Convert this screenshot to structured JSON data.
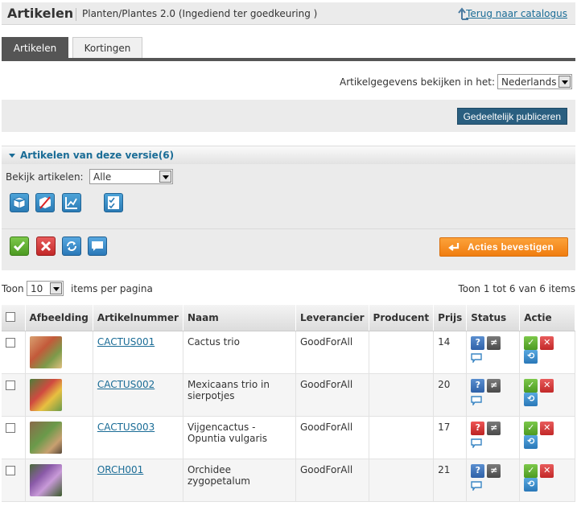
{
  "header": {
    "title": "Artikelen",
    "subtitle": "Planten/Plantes 2.0  (Ingediend ter goedkeuring )",
    "back_link": "Terug naar catalogus"
  },
  "tabs": [
    {
      "label": "Artikelen",
      "active": true
    },
    {
      "label": "Kortingen",
      "active": false
    }
  ],
  "language": {
    "label": "Artikelgegevens bekijken in het:",
    "selected": "Nederlands"
  },
  "publish_button": "Gedeeltelijk publiceren",
  "section": {
    "title": "Artikelen van deze versie(6)"
  },
  "filter": {
    "label": "Bekijk artikelen:",
    "selected": "Alle"
  },
  "filter_icons": [
    "cube-icon",
    "cube-crossed-icon",
    "chart-icon",
    "checklist-icon"
  ],
  "action_icons": [
    "check-icon",
    "cross-icon",
    "cycle-icon",
    "comment-icon"
  ],
  "confirm_button": "Acties bevestigen",
  "pager": {
    "show_label": "Toon",
    "per_page": "10",
    "per_page_label": "items per pagina",
    "summary": "Toon 1 tot 6 van 6 items"
  },
  "table": {
    "columns": [
      "",
      "Afbeelding",
      "Artikelnummer",
      "Naam",
      "Leverancier",
      "Producent",
      "Prijs",
      "Status",
      "Actie"
    ],
    "rows": [
      {
        "number": "CACTUS001",
        "name": "Cactus trio",
        "supplier": "GoodForAll",
        "producer": "",
        "price": "14",
        "status": "blue"
      },
      {
        "number": "CACTUS002",
        "name": "Mexicaans trio in sierpotjes",
        "supplier": "GoodForAll",
        "producer": "",
        "price": "20",
        "status": "blue"
      },
      {
        "number": "CACTUS003",
        "name": "Vijgencactus - Opuntia vulgaris",
        "supplier": "GoodForAll",
        "producer": "",
        "price": "17",
        "status": "red"
      },
      {
        "number": "ORCH001",
        "name": "Orchidee zygopetalum",
        "supplier": "GoodForAll",
        "producer": "",
        "price": "21",
        "status": "blue"
      }
    ]
  },
  "colors": {
    "link": "#1a6c96",
    "publish_bg": "#2a5f80",
    "confirm_bg": "#f07d10"
  }
}
